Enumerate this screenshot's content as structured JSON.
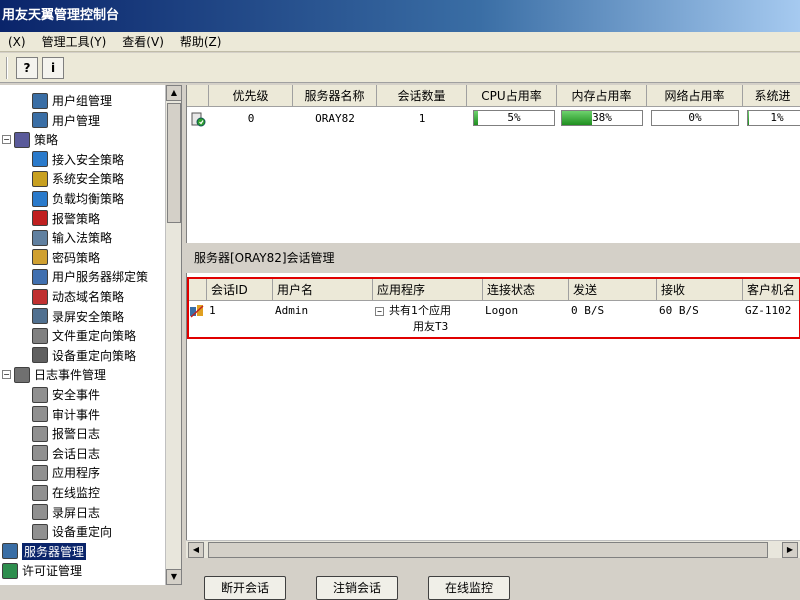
{
  "window": {
    "title": "用友天翼管理控制台"
  },
  "menu": {
    "items": [
      "(X)",
      "管理工具(Y)",
      "查看(V)",
      "帮助(Z)"
    ]
  },
  "toolbar": {
    "btn_a": "?",
    "btn_b": "i"
  },
  "tree": {
    "items": [
      {
        "label": "用户组管理",
        "icon": "user-group-icon",
        "level": 2
      },
      {
        "label": "用户管理",
        "icon": "user-icon",
        "level": 2
      },
      {
        "label": "策略",
        "icon": "policy-icon",
        "level": 1,
        "toggle": "−"
      },
      {
        "label": "接入安全策略",
        "icon": "globe-icon",
        "level": 2
      },
      {
        "label": "系统安全策略",
        "icon": "shield-icon",
        "level": 2
      },
      {
        "label": "负载均衡策略",
        "icon": "network-icon",
        "level": 2
      },
      {
        "label": "报警策略",
        "icon": "alarm-icon",
        "level": 2
      },
      {
        "label": "输入法策略",
        "icon": "keyboard-icon",
        "level": 2
      },
      {
        "label": "密码策略",
        "icon": "lock-icon",
        "level": 2
      },
      {
        "label": "用户服务器绑定策",
        "icon": "server-user-icon",
        "level": 2
      },
      {
        "label": "动态域名策略",
        "icon": "dns-icon",
        "level": 2
      },
      {
        "label": "录屏安全策略",
        "icon": "record-icon",
        "level": 2
      },
      {
        "label": "文件重定向策略",
        "icon": "file-redirect-icon",
        "level": 2
      },
      {
        "label": "设备重定向策略",
        "icon": "device-icon",
        "level": 2
      },
      {
        "label": "日志事件管理",
        "icon": "log-icon",
        "level": 1,
        "toggle": "−"
      },
      {
        "label": "安全事件",
        "icon": "log-doc-icon",
        "level": 2
      },
      {
        "label": "审计事件",
        "icon": "log-doc-icon",
        "level": 2
      },
      {
        "label": "报警日志",
        "icon": "log-doc-icon",
        "level": 2
      },
      {
        "label": "会话日志",
        "icon": "log-doc-icon",
        "level": 2
      },
      {
        "label": "应用程序",
        "icon": "log-doc-icon",
        "level": 2
      },
      {
        "label": "在线监控",
        "icon": "log-doc-icon",
        "level": 2
      },
      {
        "label": "录屏日志",
        "icon": "log-doc-icon",
        "level": 2
      },
      {
        "label": "设备重定向",
        "icon": "log-doc-icon",
        "level": 2
      },
      {
        "label": "服务器管理",
        "icon": "server-icon",
        "level": 1,
        "selected": true
      },
      {
        "label": "许可证管理",
        "icon": "license-icon",
        "level": 1
      }
    ]
  },
  "servers": {
    "columns": [
      "优先级",
      "服务器名称",
      "会话数量",
      "CPU占用率",
      "内存占用率",
      "网络占用率",
      "系统进"
    ],
    "row": {
      "priority": "0",
      "name": "ORAY82",
      "sessions": "1",
      "cpu": "5%",
      "cpu_level": 5,
      "mem": "38%",
      "mem_level": 38,
      "net": "0%",
      "net_level": 0,
      "sys": "1%",
      "sys_level": 1
    }
  },
  "session_panel": {
    "title": "服务器[ORAY82]会话管理"
  },
  "sessions": {
    "columns": [
      "会话ID",
      "用户名",
      "应用程序",
      "连接状态",
      "发送",
      "接收",
      "客户机名"
    ],
    "row": {
      "id": "1",
      "user": "Admin",
      "app_line1": "共有1个应用",
      "app_line2": "用友T3",
      "state": "Logon",
      "sent": "0 B/S",
      "recv": "60 B/S",
      "client": "GZ-1102"
    }
  },
  "actions": {
    "disconnect": "断开会话",
    "logoff": "注销会话",
    "monitor": "在线监控"
  }
}
